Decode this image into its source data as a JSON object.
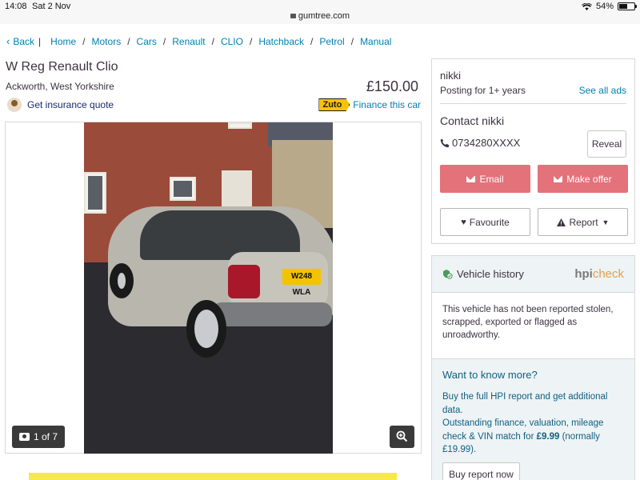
{
  "status_bar": {
    "time": "14:08",
    "date": "Sat 2 Nov",
    "url": "gumtree.com",
    "battery": "54%"
  },
  "breadcrumb": {
    "back": "Back",
    "items": [
      "Home",
      "Motors",
      "Cars",
      "Renault",
      "CLIO",
      "Hatchback",
      "Petrol",
      "Manual"
    ]
  },
  "listing": {
    "title": "W Reg Renault Clio",
    "location": "Ackworth, West Yorkshire",
    "price": "£150.00",
    "insurance_link": "Get insurance quote",
    "finance_brand": "Zuto",
    "finance_link": "Finance this car"
  },
  "gallery": {
    "counter": "1 of 7",
    "plate": "W248 WLA"
  },
  "seller": {
    "name": "nikki",
    "posting": "Posting for 1+ years",
    "see_all": "See all ads",
    "contact_title": "Contact nikki",
    "phone": "0734280XXXX",
    "reveal": "Reveal",
    "email": "Email",
    "make_offer": "Make offer",
    "favourite": "Favourite",
    "report": "Report"
  },
  "vehicle_history": {
    "title": "Vehicle history",
    "hpi_a": "hpi",
    "hpi_b": "check",
    "body": "This vehicle has not been reported stolen, scrapped, exported or flagged as unroadworthy.",
    "more_title": "Want to know more?",
    "more_line1": "Buy the full HPI report and get additional data.",
    "more_line2a": "Outstanding finance, valuation, mileage check & VIN match for ",
    "more_price": "£9.99",
    "more_line2b": " (normally £19.99).",
    "buy_button": "Buy report now"
  },
  "colors": {
    "link": "#007fb0",
    "accent_red": "#e3727a",
    "text": "#3c3241"
  }
}
